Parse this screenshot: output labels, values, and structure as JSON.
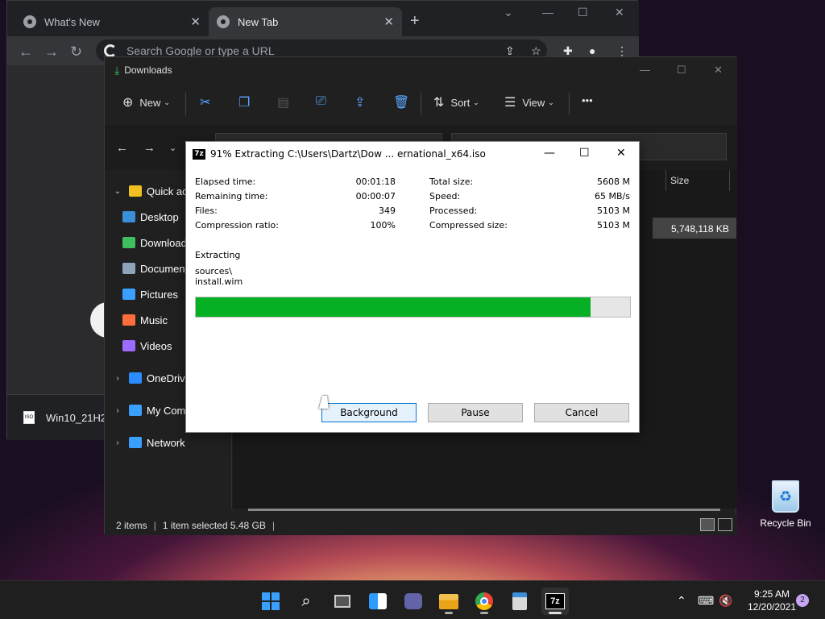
{
  "chrome": {
    "tabs": [
      {
        "label": "What's New"
      },
      {
        "label": "New Tab"
      }
    ],
    "omnibox_placeholder": "Search Google or type a URL",
    "download_item": "Win10_21H2",
    "window_controls": {
      "min": "⌄",
      "max": "—",
      "restore": "☐",
      "close": "✕"
    }
  },
  "explorer": {
    "title": "Downloads",
    "commands": {
      "new": "New",
      "sort": "Sort",
      "view": "View",
      "more": "•••"
    },
    "nav_items": [
      {
        "label": "Quick access",
        "chev": "⌄",
        "color": "#f0c020"
      },
      {
        "label": "Desktop",
        "chev": "",
        "color": "#3a8fd8"
      },
      {
        "label": "Downloads",
        "chev": "",
        "color": "#3fbf5f"
      },
      {
        "label": "Documents",
        "chev": "",
        "color": "#8fa3b8"
      },
      {
        "label": "Pictures",
        "chev": "",
        "color": "#3aa0ff"
      },
      {
        "label": "Music",
        "chev": "",
        "color": "#ff6d3a"
      },
      {
        "label": "Videos",
        "chev": "",
        "color": "#9b6cff"
      },
      {
        "label": "OneDrive",
        "chev": "›",
        "color": "#2b8cff"
      },
      {
        "label": "My Computer",
        "chev": "›",
        "color": "#3aa0ff"
      },
      {
        "label": "Network",
        "chev": "›",
        "color": "#3aa0ff"
      }
    ],
    "column_size": "Size",
    "file_size": "5,748,118 KB",
    "status": {
      "items": "2 items",
      "selected": "1 item selected  5.48 GB"
    }
  },
  "dialog": {
    "title": "91% Extracting C:\\Users\\Dartz\\Dow ... ernational_x64.iso",
    "stats_left": [
      {
        "label": "Elapsed time:",
        "value": "00:01:18"
      },
      {
        "label": "Remaining time:",
        "value": "00:00:07"
      },
      {
        "label": "Files:",
        "value": "349"
      },
      {
        "label": "Compression ratio:",
        "value": "100%"
      }
    ],
    "stats_right": [
      {
        "label": "Total size:",
        "value": "5608 M"
      },
      {
        "label": "Speed:",
        "value": "65 MB/s"
      },
      {
        "label": "Processed:",
        "value": "5103 M"
      },
      {
        "label": "Compressed size:",
        "value": "5103 M"
      }
    ],
    "operation": "Extracting",
    "current_dir": "sources\\",
    "current_file": "install.wim",
    "progress": 0.91,
    "buttons": {
      "background": "Background",
      "pause": "Pause",
      "cancel": "Cancel"
    }
  },
  "desktop": {
    "recycle_bin": "Recycle Bin"
  },
  "taskbar": {
    "time": "9:25 AM",
    "date": "12/20/2021",
    "notifications": "2",
    "apps": [
      "start",
      "search",
      "task-view",
      "widgets",
      "teams-chat",
      "file-explorer",
      "chrome",
      "calculator",
      "7zip"
    ]
  }
}
